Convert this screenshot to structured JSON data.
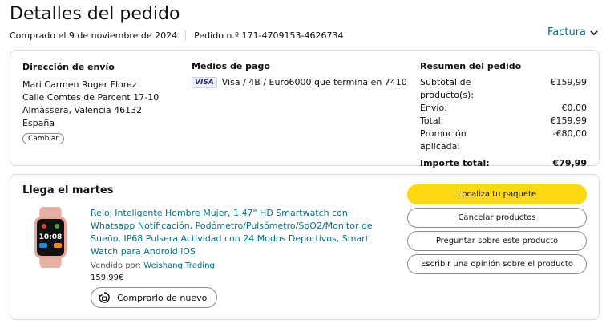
{
  "header": {
    "title": "Detalles del pedido",
    "purchase_date": "Comprado el 9 de noviembre de 2024",
    "order_number": "Pedido n.º 171-4709153-4626734",
    "invoice_label": "Factura"
  },
  "shipping": {
    "heading": "Dirección de envío",
    "name": "Mari Carmen Roger Florez",
    "street": "Calle Comtes de Parcent 17-10",
    "city": "Almàssera, Valencia 46132",
    "country": "España",
    "change_button": "Cambiar"
  },
  "payment": {
    "heading": "Medios de pago",
    "card_brand": "VISA",
    "card_text": "Visa / 4B / Euro6000 que termina en 7410"
  },
  "summary": {
    "heading": "Resumen del pedido",
    "rows": [
      {
        "label": "Subtotal de producto(s):",
        "value": "€159,99"
      },
      {
        "label": "Envío:",
        "value": "€0,00"
      },
      {
        "label": "Total:",
        "value": "€159,99"
      },
      {
        "label": "Promoción aplicada:",
        "value": "-€80,00"
      }
    ],
    "grand_total_label": "Importe total:",
    "grand_total_value": "€79,99"
  },
  "shipment": {
    "arrival": "Llega el martes",
    "product_title": "Reloj Inteligente Hombre Mujer, 1.47\" HD Smartwatch con Whatsapp Notificación, Podómetro/Pulsómetro/SpO2/Monitor de Sueño, IP68 Pulsera Actividad con 24 Modos Deportivos, Smart Watch para Android iOS",
    "sold_by_label": "Vendido por:",
    "seller": "Weishang Trading",
    "price": "159,99€",
    "buy_again": "Comprarlo de nuevo",
    "watch_time": "10:08",
    "actions": [
      "Localiza tu paquete",
      "Cancelar productos",
      "Preguntar sobre este producto",
      "Escribir una opinión sobre el producto"
    ]
  },
  "colors": {
    "link": "#007185",
    "primary_button": "#FFD814",
    "border": "#D5D9D9"
  }
}
